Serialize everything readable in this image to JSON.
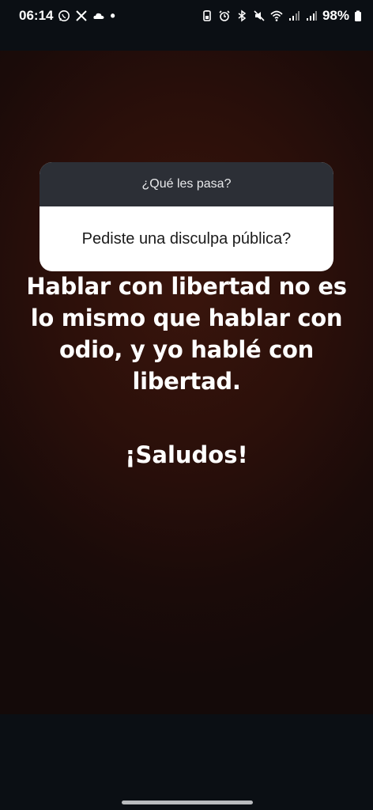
{
  "status_bar": {
    "time": "06:14",
    "battery": "98%",
    "left_icons": [
      "whatsapp-icon",
      "x-icon",
      "cloud-icon",
      "dot-icon"
    ],
    "right_icons": [
      "battery-saver-icon",
      "alarm-icon",
      "bluetooth-icon",
      "mute-icon",
      "wifi-icon",
      "signal-icon",
      "signal-icon",
      "battery-icon"
    ]
  },
  "question_card": {
    "header": "¿Qué les pasa?",
    "question": "Pediste una disculpa pública?"
  },
  "message": {
    "body": "Hablar con libertad no es lo mismo que hablar con odio, y yo hablé con libertad.",
    "greeting": "¡Saludos!"
  },
  "colors": {
    "background_top": "#3a150c",
    "background_edge": "#140a09",
    "card_header": "#2c2f36",
    "card_body": "#ffffff",
    "text": "#ffffff"
  }
}
